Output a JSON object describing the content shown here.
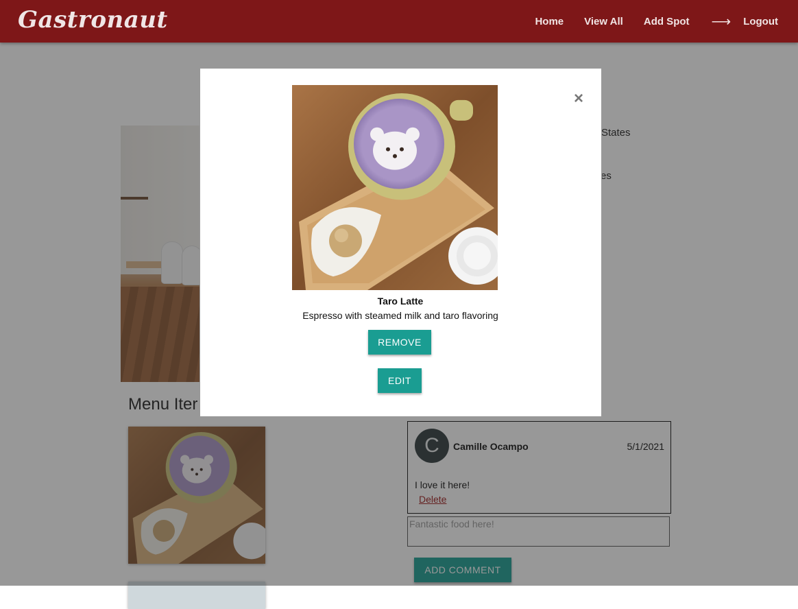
{
  "navbar": {
    "brand": "Gastronaut",
    "links": {
      "home": "Home",
      "view_all": "View All",
      "add_spot": "Add Spot",
      "arrow": "⟶",
      "logout": "Logout"
    }
  },
  "spot": {
    "address_fragment": "States",
    "tags_fragment": "es"
  },
  "menu": {
    "heading": "Menu Iter"
  },
  "comments": [
    {
      "avatar_initial": "C",
      "author": "Camille Ocampo",
      "date": "5/1/2021",
      "text": "I love it here!",
      "delete_label": "Delete"
    }
  ],
  "comment_form": {
    "placeholder": "Fantastic food here!",
    "submit_label": "ADD COMMENT"
  },
  "modal": {
    "close_glyph": "×",
    "item_name": "Taro Latte",
    "item_description": "Espresso with steamed milk and taro flavoring",
    "remove_label": "REMOVE",
    "edit_label": "EDIT"
  },
  "colors": {
    "navbar": "#7e1718",
    "accent_teal": "#1a9d92",
    "link_red": "#9b1a1a"
  }
}
